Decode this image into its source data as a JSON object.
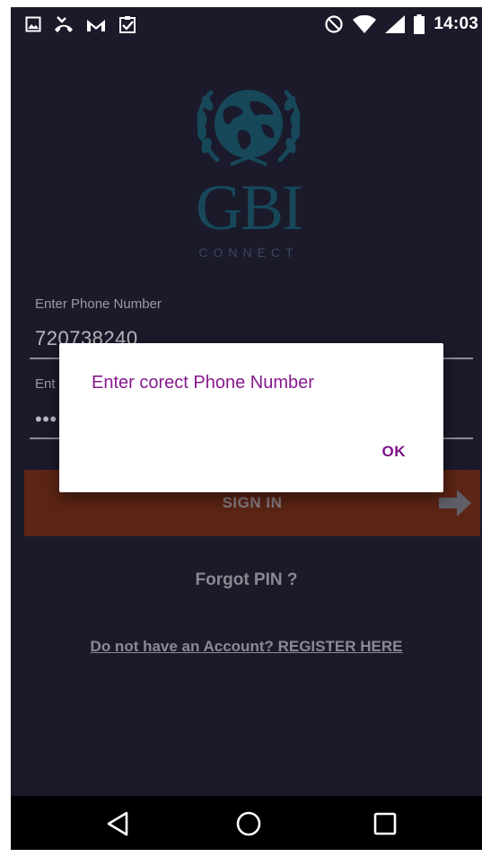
{
  "status_bar": {
    "time": "14:03",
    "left_icons": [
      "image-icon",
      "missed-call-icon",
      "gmail-icon",
      "clipboard-check-icon"
    ],
    "right_icons": [
      "do-not-disturb-icon",
      "wifi-icon",
      "signal-icon",
      "battery-icon"
    ]
  },
  "logo": {
    "title": "GBI",
    "subtitle": "CONNECT",
    "color": "#17485a"
  },
  "form": {
    "phone_label": "Enter Phone Number",
    "phone_value": "720738240",
    "pin_label": "Ent",
    "pin_value": "•••",
    "signin_label": "SIGN IN"
  },
  "links": {
    "forgot": "Forgot PIN ?",
    "register": "Do not have an Account? REGISTER HERE"
  },
  "dialog": {
    "message": "Enter corect Phone Number",
    "ok_label": "OK"
  },
  "colors": {
    "background": "#1a1a2b",
    "signin_button": "#5c2515",
    "dialog_accent": "#86198e"
  }
}
